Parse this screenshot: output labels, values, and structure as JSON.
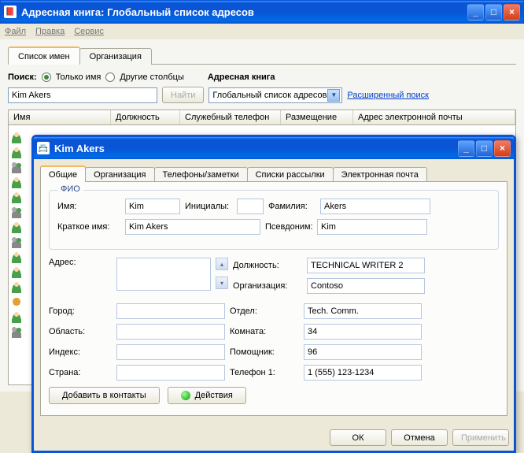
{
  "mainWindow": {
    "title": "Адресная книга: Глобальный список адресов",
    "menu": {
      "file": "Файл",
      "edit": "Правка",
      "service": "Сервис"
    }
  },
  "tabs": {
    "names": "Список имен",
    "org": "Организация"
  },
  "search": {
    "label": "Поиск:",
    "opt1": "Только имя",
    "opt2": "Другие столбцы",
    "bookLabel": "Адресная книга",
    "value": "Kim Akers",
    "goBtn": "Найти",
    "bookValue": "Глобальный список адресов",
    "advanced": "Расширенный поиск"
  },
  "columns": {
    "name": "Имя",
    "title": "Должность",
    "phone": "Служебный телефон",
    "location": "Размещение",
    "email": "Адрес электронной почты"
  },
  "childWindow": {
    "title": "Kim Akers",
    "tabs": {
      "general": "Общие",
      "org": "Организация",
      "phones": "Телефоны/заметки",
      "lists": "Списки рассылки",
      "email": "Электронная почта"
    },
    "fio": {
      "legend": "ФИО",
      "nameLabel": "Имя:",
      "name": "Kim",
      "initLabel": "Инициалы:",
      "init": "",
      "lastLabel": "Фамилия:",
      "last": "Akers",
      "shortLabel": "Краткое имя:",
      "short": "Kim Akers",
      "aliasLabel": "Псевдоним:",
      "alias": "Kim"
    },
    "fields": {
      "addrLabel": "Адрес:",
      "addr": "",
      "jobLabel": "Должность:",
      "job": "TECHNICAL WRITER 2",
      "orgLabel": "Организация:",
      "org": "Contoso",
      "cityLabel": "Город:",
      "city": "",
      "deptLabel": "Отдел:",
      "dept": "Tech. Comm.",
      "regionLabel": "Область:",
      "region": "",
      "roomLabel": "Комната:",
      "room": "34",
      "zipLabel": "Индекс:",
      "zip": "",
      "asstLabel": "Помощник:",
      "asst": "96",
      "countryLabel": "Страна:",
      "country": "",
      "phoneLabel": "Телефон 1:",
      "phone": "1 (555) 123-1234"
    },
    "btns": {
      "add": "Добавить в контакты",
      "actions": "Действия",
      "ok": "ОК",
      "cancel": "Отмена",
      "apply": "Применить"
    }
  }
}
